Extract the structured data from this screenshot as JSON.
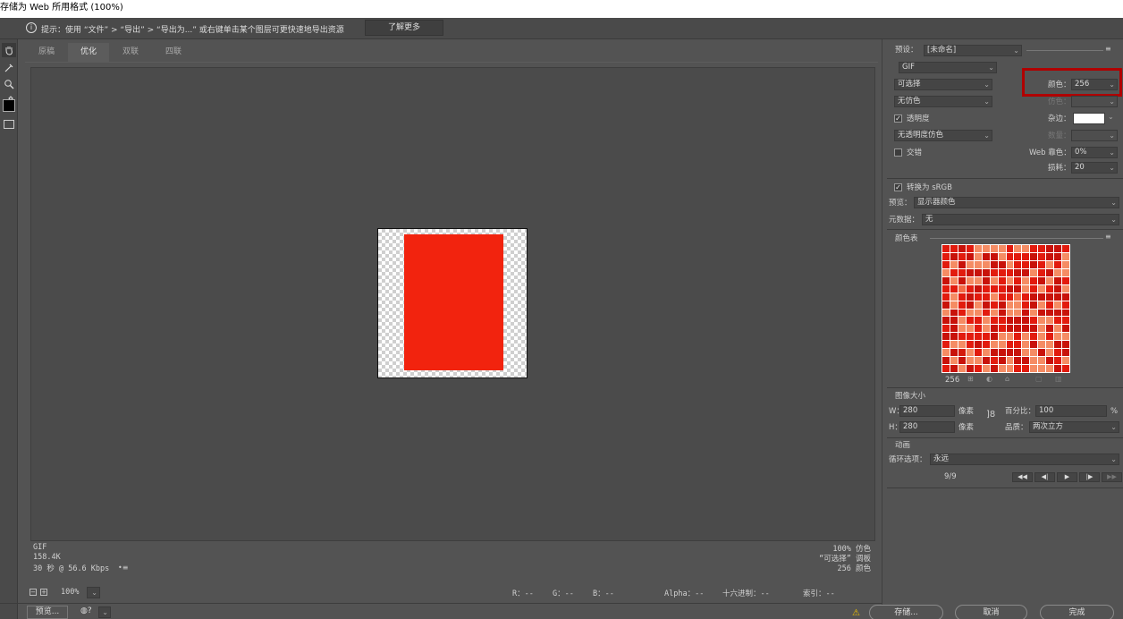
{
  "window": {
    "title": "存储为 Web 所用格式 (100%)"
  },
  "infobar": {
    "tip": "提示：使用 “文件” > “导出” > “导出为...” 或右键单击某个图层可更快速地导出资源",
    "learn_more": "了解更多"
  },
  "tools": [
    "hand-tool-icon",
    "slice-select-icon",
    "zoom-icon",
    "eyedropper-icon"
  ],
  "tabs": [
    {
      "label": "原稿",
      "active": false
    },
    {
      "label": "优化",
      "active": true
    },
    {
      "label": "双联",
      "active": false
    },
    {
      "label": "四联",
      "active": false
    }
  ],
  "canvas": {
    "info_left": [
      "GIF",
      "158.4K",
      "30 秒 @ 56.6 Kbps"
    ],
    "info_right": [
      "100% 仿色",
      "“可选择” 调板",
      "256 颜色"
    ],
    "image_color": "#f2230e"
  },
  "settings": {
    "preset_label": "预设：",
    "preset_value": "[未命名]",
    "format": "GIF",
    "reduction": "可选择",
    "dither": "无仿色",
    "colors_label": "颜色：",
    "colors_value": "256",
    "dither_amount_label": "仿色：",
    "transparency_label": "透明度",
    "transparency_checked": true,
    "matte_label": "杂边：",
    "matte_color": "#ffffff",
    "trans_dither": "无透明度仿色",
    "amount_label": "数量：",
    "interlaced_label": "交错",
    "interlaced_checked": false,
    "websnap_label": "Web 靠色：",
    "websnap_value": "0%",
    "lossy_label": "损耗：",
    "lossy_value": "20",
    "convert_srgb_label": "转换为 sRGB",
    "convert_srgb_checked": true,
    "preview_label": "预览：",
    "preview_value": "显示器颜色",
    "metadata_label": "元数据：",
    "metadata_value": "无"
  },
  "color_table": {
    "title": "颜色表",
    "count": "256"
  },
  "image_size": {
    "title": "图像大小",
    "w_label": "W：",
    "w_value": "280",
    "h_label": "H：",
    "h_value": "280",
    "unit": "像素",
    "percent_label": "百分比：",
    "percent_value": "100",
    "percent_unit": "%",
    "quality_label": "品质：",
    "quality_value": "两次立方"
  },
  "animation": {
    "title": "动画",
    "loop_label": "循环选项：",
    "loop_value": "永远",
    "frame": "9/9"
  },
  "bottom": {
    "zoom": "100%",
    "r": "R：--",
    "g": "G：--",
    "b": "B：--",
    "alpha": "Alpha：--",
    "hex": "十六进制：--",
    "index": "索引：--",
    "preview_button": "预览...",
    "save_button": "存储...",
    "cancel_button": "取消",
    "done_button": "完成"
  },
  "highlight_color": "#b00000"
}
